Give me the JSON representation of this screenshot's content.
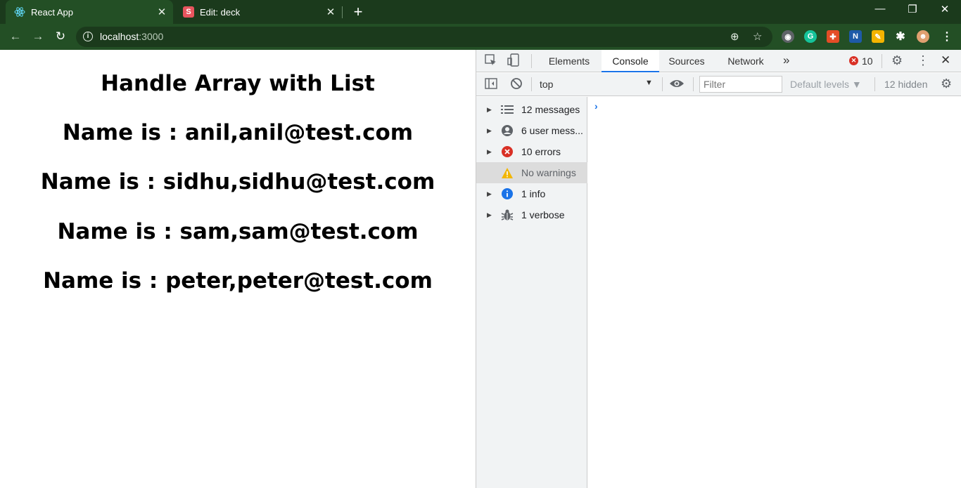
{
  "browser": {
    "tabs": [
      {
        "title": "React App",
        "favicon": "react-icon",
        "close": "✕"
      },
      {
        "title": "Edit: deck",
        "favicon": "s-icon",
        "favicon_letter": "S",
        "close": "✕"
      }
    ],
    "new_tab": "+",
    "window_controls": {
      "minimize": "—",
      "restore": "❐",
      "close": "✕"
    },
    "nav": {
      "back": "←",
      "forward": "→",
      "reload": "↻"
    },
    "address": {
      "host": "localhost",
      "port": ":3000",
      "info_icon": "i"
    },
    "omnibox_icons": {
      "zoom": "⊕",
      "star": "☆"
    },
    "extensions": [
      {
        "name": "record-icon",
        "color": "#5f6368",
        "glyph": "◉"
      },
      {
        "name": "grammarly-icon",
        "color": "#15c39a",
        "glyph": "G"
      },
      {
        "name": "extension-red-icon",
        "color": "#e44d26",
        "glyph": "✚"
      },
      {
        "name": "n-extension-icon",
        "color": "#1e5aa8",
        "glyph": "N"
      },
      {
        "name": "pencil-icon",
        "color": "#f4b400",
        "glyph": "✎"
      },
      {
        "name": "puzzle-icon",
        "color": "#234f25",
        "glyph": "✱"
      },
      {
        "name": "profile-avatar-icon",
        "color": "#e0a070",
        "glyph": "☻"
      },
      {
        "name": "menu-icon",
        "color": "#234f25",
        "glyph": "⋮"
      }
    ]
  },
  "page": {
    "heading": "Handle Array with List",
    "rows": [
      "Name is : anil,anil@test.com",
      "Name is : sidhu,sidhu@test.com",
      "Name is : sam,sam@test.com",
      "Name is : peter,peter@test.com"
    ]
  },
  "devtools": {
    "tabs": [
      "Elements",
      "Console",
      "Sources",
      "Network"
    ],
    "active_tab": "Console",
    "more_tabs": "»",
    "error_count": "10",
    "context": "top",
    "filter_placeholder": "Filter",
    "levels": "Default levels ▼",
    "hidden": "12 hidden",
    "sidebar": [
      {
        "label": "12 messages",
        "icon": "list-icon"
      },
      {
        "label": "6 user mess...",
        "icon": "user-icon"
      },
      {
        "label": "10 errors",
        "icon": "error-icon"
      },
      {
        "label": "No warnings",
        "icon": "warning-icon"
      },
      {
        "label": "1 info",
        "icon": "info-icon"
      },
      {
        "label": "1 verbose",
        "icon": "bug-icon"
      }
    ],
    "prompt": "›",
    "colors": {
      "accent": "#1a73e8",
      "error": "#d93025",
      "warning": "#f2b600",
      "info": "#1a73e8"
    }
  }
}
